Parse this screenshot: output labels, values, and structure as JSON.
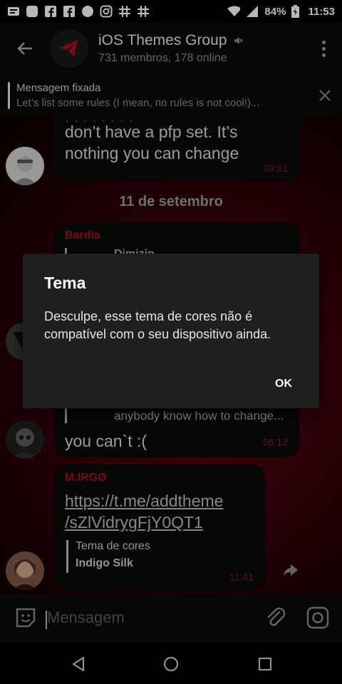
{
  "status_bar": {
    "battery": "84%",
    "time": "11:53"
  },
  "header": {
    "title": "iOS Themes Group",
    "subtitle": "731 membros, 178 online"
  },
  "pinned": {
    "title": "Mensagem fixada",
    "message": "Let’s list some rules (I mean, no rules is not cool!)..."
  },
  "messages": {
    "m1": {
      "lines": [
        "don’t have a pfp set. It’s",
        "nothing you can change"
      ],
      "time": "03:31"
    },
    "date": "11 de setembro",
    "m2": {
      "sender": "Bardia",
      "reply_preview": "Dimizin"
    },
    "m3": {
      "reply_preview": "anybody know how to change...",
      "text": "you can`t :(",
      "time": "06:12"
    },
    "m4": {
      "sender": "M.IRGØ",
      "link_lines": [
        "https://t.me/addtheme",
        "/sZlVidrygFjY0QT1"
      ],
      "preview_title": "Tema de cores",
      "preview_sub": "Indigo Silk",
      "time": "11:41"
    }
  },
  "dialog": {
    "title": "Tema",
    "body": "Desculpe, esse tema de cores não é compatível com o seu dispositivo ainda.",
    "ok_label": "OK"
  },
  "input": {
    "placeholder": "Mensagem"
  },
  "colors": {
    "accent": "#a50f1d",
    "bubble": "#0a0a0a",
    "dialog_bg": "#1f1f1f"
  }
}
